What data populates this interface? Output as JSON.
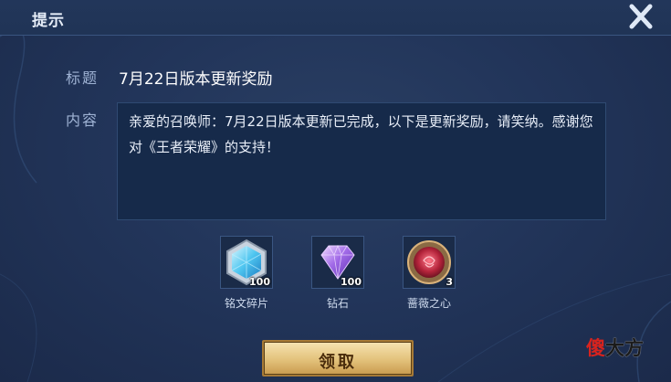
{
  "dialog": {
    "header_title": "提示",
    "title_label": "标题",
    "title_value": "7月22日版本更新奖励",
    "content_label": "内容",
    "content_text": "亲爱的召唤师：7月22日版本更新已完成，以下是更新奖励，请笑纳。感谢您对《王者荣耀》的支持！"
  },
  "rewards": [
    {
      "name": "铭文碎片",
      "count": "100",
      "icon": "inscription-fragment-icon"
    },
    {
      "name": "钻石",
      "count": "100",
      "icon": "diamond-icon"
    },
    {
      "name": "蔷薇之心",
      "count": "3",
      "icon": "rose-heart-icon"
    }
  ],
  "claim_button": "领取",
  "watermark": {
    "part1": "傻",
    "part2": "大方"
  },
  "colors": {
    "panel": "#22355a",
    "content_bg": "#162a4a",
    "button_gold": "#e3c27b",
    "label": "#9fb3d4"
  }
}
